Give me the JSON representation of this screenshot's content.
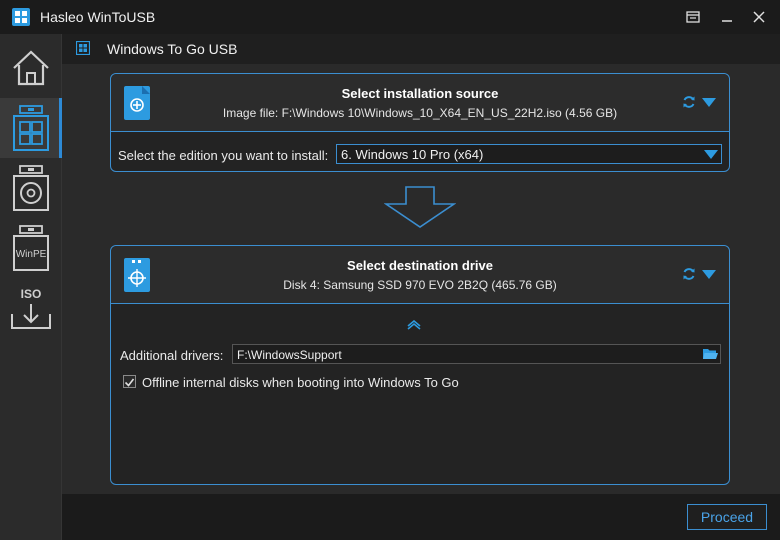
{
  "window": {
    "title": "Hasleo WinToUSB"
  },
  "sidebar": {
    "items": [
      {
        "name": "home",
        "label": ""
      },
      {
        "name": "windows-to-go",
        "label": ""
      },
      {
        "name": "disc",
        "label": ""
      },
      {
        "name": "winpe",
        "label": "WinPE"
      },
      {
        "name": "iso",
        "label": "ISO"
      }
    ]
  },
  "page": {
    "title": "Windows To Go USB"
  },
  "source": {
    "title": "Select installation source",
    "subtitle": "Image file: F:\\Windows 10\\Windows_10_X64_EN_US_22H2.iso (4.56 GB)",
    "edition_label": "Select the edition you want to install:",
    "edition_value": "6. Windows 10 Pro (x64)"
  },
  "destination": {
    "title": "Select destination drive",
    "subtitle": "Disk 4: Samsung SSD 970 EVO 2B2Q (465.76 GB)",
    "drivers_label": "Additional drivers:",
    "drivers_value": "F:\\WindowsSupport",
    "offline_label": "Offline internal disks when booting into Windows To Go",
    "offline_checked": true
  },
  "footer": {
    "proceed_label": "Proceed"
  },
  "colors": {
    "accent": "#3b8ed0",
    "icon_blue": "#2d9be0"
  }
}
